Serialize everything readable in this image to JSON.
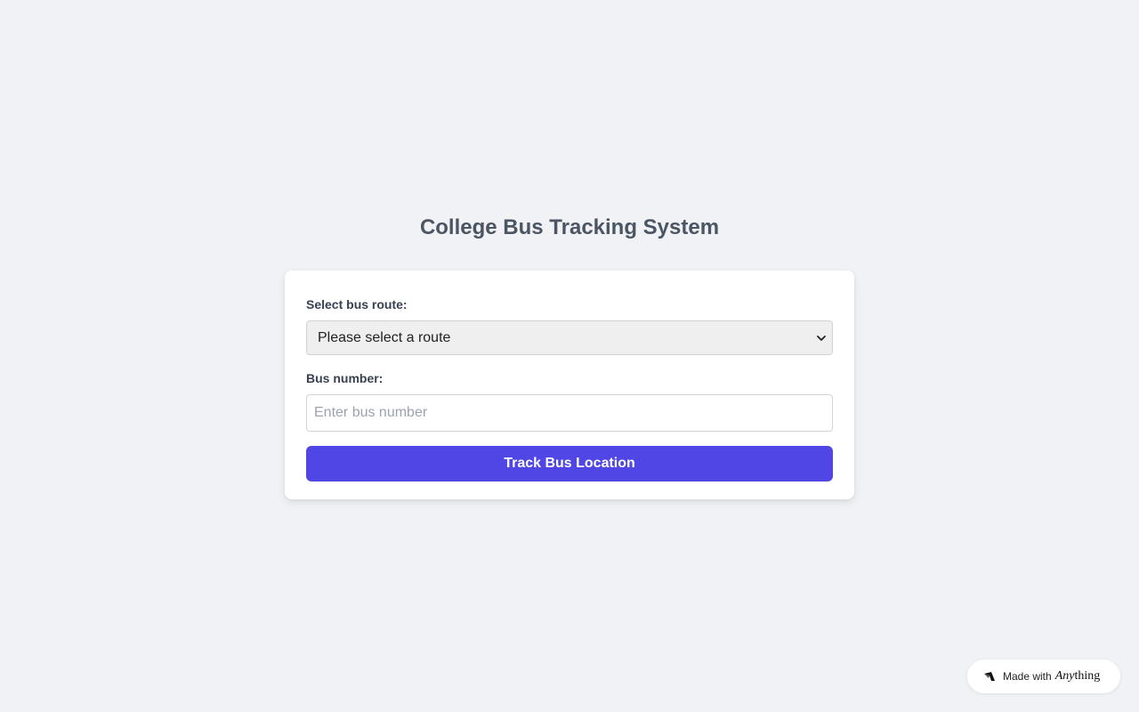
{
  "header": {
    "title": "College Bus Tracking System"
  },
  "form": {
    "route_label": "Select bus route:",
    "route_selected": "Please select a route",
    "bus_number_label": "Bus number:",
    "bus_number_placeholder": "Enter bus number",
    "bus_number_value": "",
    "submit_label": "Track Bus Location"
  },
  "badge": {
    "made_with": "Made with",
    "brand_prefix": "Any",
    "brand_suffix": "thing"
  },
  "icons": {
    "select_arrow": "chevron-down-icon",
    "badge_logo": "anything-logo-icon"
  },
  "colors": {
    "background": "#f0f2f5",
    "title": "#4b5563",
    "primary_button": "#4f46e5",
    "card": "#ffffff"
  }
}
